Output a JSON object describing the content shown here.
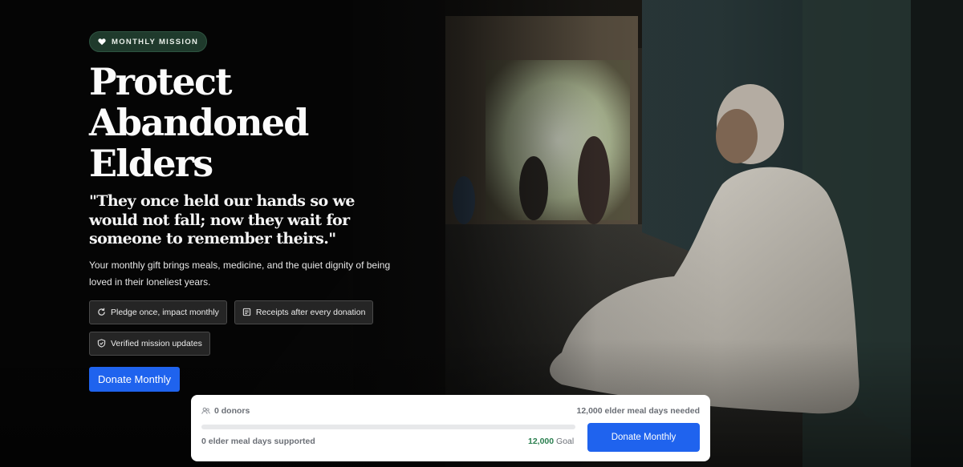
{
  "hero": {
    "badge": {
      "icon": "heart-icon",
      "label": "MONTHLY MISSION"
    },
    "title_lines": [
      "Protect",
      "Abandoned",
      "Elders"
    ],
    "quote": "\"They once held our hands so we would not fall; now they wait for someone to remember theirs.\"",
    "description": "Your monthly gift brings meals, medicine, and the quiet dignity of being loved in their loneliest years.",
    "features": [
      {
        "icon": "refresh-icon",
        "label": "Pledge once, impact monthly"
      },
      {
        "icon": "receipt-icon",
        "label": "Receipts after every donation"
      },
      {
        "icon": "shield-check-icon",
        "label": "Verified mission updates"
      }
    ],
    "cta_label": "Donate Monthly"
  },
  "progress": {
    "donors_icon": "users-icon",
    "donors_text": "0 donors",
    "needed_text": "12,000 elder meal days needed",
    "progress_fraction": 0,
    "supported_text": "0 elder meal days supported",
    "goal_value": "12,000",
    "goal_label": "Goal",
    "cta_label": "Donate Monthly"
  },
  "colors": {
    "accent_blue": "#1f63ee",
    "badge_green": "#1f3a2c",
    "goal_green": "#2a7f4f"
  }
}
